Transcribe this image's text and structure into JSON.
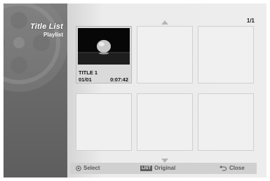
{
  "sidebar": {
    "title": "Title List",
    "subtitle": "Playlist"
  },
  "page_indicator": "1/1",
  "titles": [
    {
      "name": "TITLE 1",
      "index": "01/01",
      "length": "0:07:42"
    }
  ],
  "footer": {
    "select_label": "Select",
    "list_key": "LIST",
    "original_label": "Original",
    "close_label": "Close"
  }
}
